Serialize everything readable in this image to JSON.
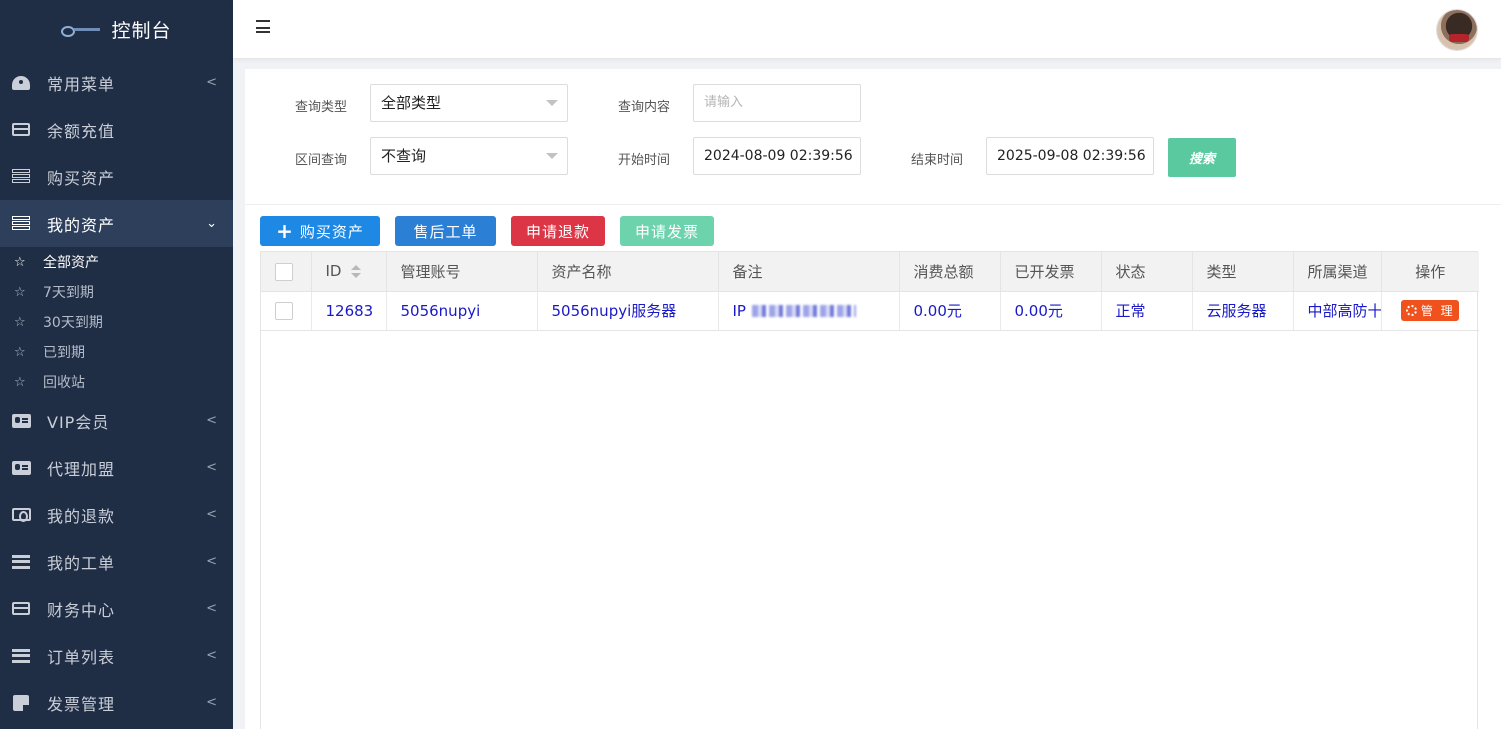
{
  "sidebar": {
    "brand_title": "控制台",
    "menu": [
      {
        "label": "常用菜单",
        "icon": "dashboard-icon"
      },
      {
        "label": "余额充值",
        "icon": "credit-card-icon"
      },
      {
        "label": "购买资产",
        "icon": "server-icon"
      },
      {
        "label": "我的资产",
        "icon": "server-icon"
      },
      {
        "label": "VIP会员",
        "icon": "id-card-icon"
      },
      {
        "label": "代理加盟",
        "icon": "id-card-icon"
      },
      {
        "label": "我的退款",
        "icon": "money-icon"
      },
      {
        "label": "我的工单",
        "icon": "list-icon"
      },
      {
        "label": "财务中心",
        "icon": "credit-card-icon"
      },
      {
        "label": "订单列表",
        "icon": "list-icon"
      },
      {
        "label": "发票管理",
        "icon": "note-icon"
      }
    ],
    "submenu": [
      {
        "label": "全部资产"
      },
      {
        "label": "7天到期"
      },
      {
        "label": "30天到期"
      },
      {
        "label": "已到期"
      },
      {
        "label": "回收站"
      }
    ]
  },
  "filters": {
    "query_type_label": "查询类型",
    "query_type_value": "全部类型",
    "query_content_label": "查询内容",
    "query_content_placeholder": "请输入",
    "range_label": "区间查询",
    "range_value": "不查询",
    "start_label": "开始时间",
    "start_value": "2024-08-09 02:39:56",
    "end_label": "结束时间",
    "end_value": "2025-09-08 02:39:56",
    "search_label": "搜索"
  },
  "actions": {
    "buy": "购买资产",
    "aftersale": "售后工单",
    "refund": "申请退款",
    "invoice": "申请发票"
  },
  "table": {
    "headers": [
      "ID",
      "管理账号",
      "资产名称",
      "备注",
      "消费总额",
      "已开发票",
      "状态",
      "类型",
      "所属渠道",
      "操作"
    ],
    "rows": [
      {
        "id": "12683",
        "account": "5056nupyi",
        "asset_name": "5056nupyi服务器",
        "note_prefix": "IP",
        "total": "0.00元",
        "invoiced": "0.00元",
        "status": "正常",
        "type": "云服务器",
        "channel": "中部高防十",
        "action": "管 理"
      }
    ]
  },
  "colors": {
    "sidebar_bg": "#1f2d45",
    "primary_blue": "#1e88e5",
    "danger_red": "#dc3545",
    "success_green": "#5bc9a0",
    "manage_orange": "#f0521e",
    "link_blue": "#1919c8"
  }
}
